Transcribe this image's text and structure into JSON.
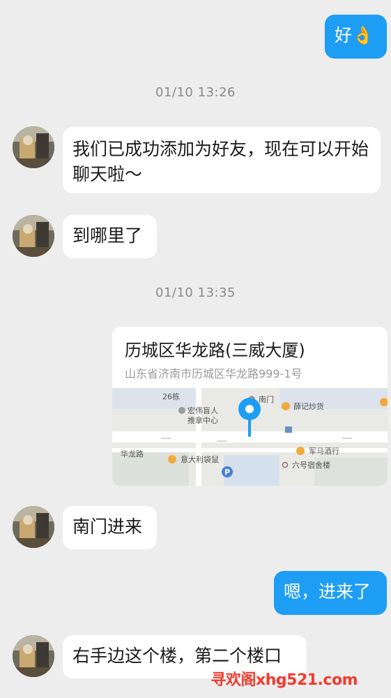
{
  "messages": {
    "m1": {
      "text": "好👌"
    },
    "t1": {
      "text": "01/10 13:26"
    },
    "m2": {
      "text": "我们已成功添加为好友，现在可以开始聊天啦～"
    },
    "m3": {
      "text": "到哪里了"
    },
    "t2": {
      "text": "01/10 13:35"
    },
    "location": {
      "title": "历城区华龙路(三威大厦)",
      "address": "山东省济南市历城区华龙路999-1号",
      "map_labels": {
        "bldg26": "26栋",
        "nanmen": "南门",
        "xueji": "薛记炒货",
        "hongwei1": "宏伟盲人",
        "hongwei2": "推拿中心",
        "hualonglu": "华龙路",
        "junma": "军马酒行",
        "yidali": "意大利袋鼠",
        "liuhao": "六号宿舍楼",
        "parking": "P"
      }
    },
    "m4": {
      "text": "南门进来"
    },
    "m5": {
      "text": "嗯，进来了"
    },
    "m6": {
      "text": "右手边这个楼，第二个楼口"
    }
  },
  "watermark": {
    "text": "寻欢阁xhg521.com"
  },
  "colors": {
    "background": "#EDEDED",
    "incoming_bubble": "#FFFFFF",
    "outgoing_bubble": "#1E9DF5",
    "timestamp": "#8A8A8A",
    "map_pin": "#1E9DF5",
    "watermark": "#F03C2E"
  },
  "icons": {
    "avatar": "user-avatar-photo",
    "map_pin": "map-pin-icon",
    "poi": "poi-marker-icon"
  }
}
